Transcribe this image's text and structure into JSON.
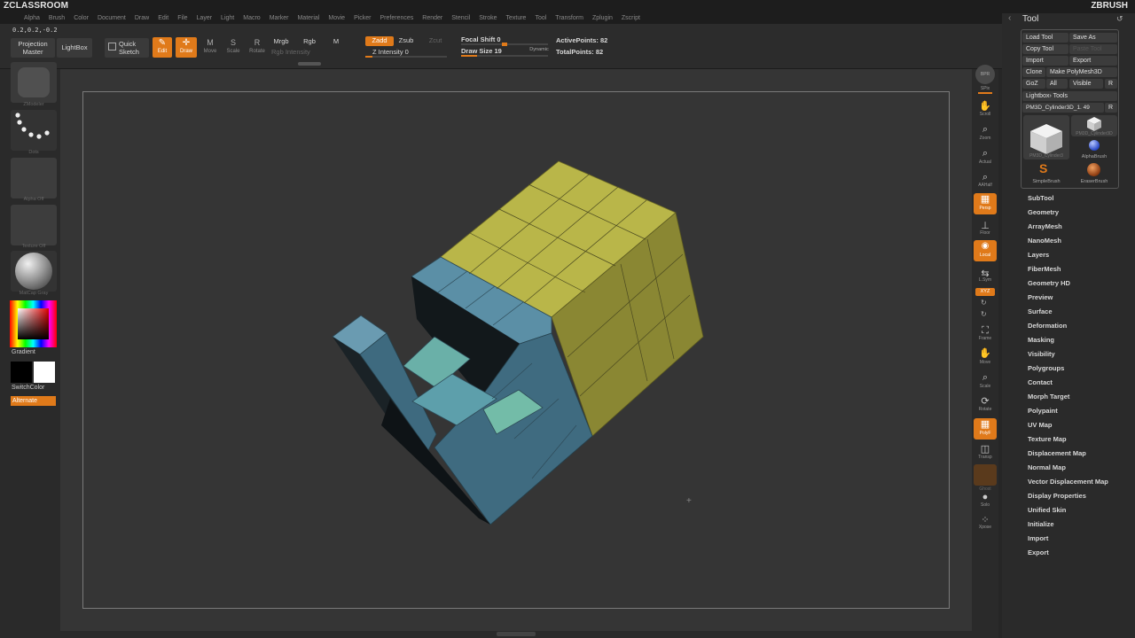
{
  "app": {
    "title": "ZCLASSROOM",
    "brand": "ZBRUSH"
  },
  "menubar": [
    "Alpha",
    "Brush",
    "Color",
    "Document",
    "Draw",
    "Edit",
    "File",
    "Layer",
    "Light",
    "Macro",
    "Marker",
    "Material",
    "Movie",
    "Picker",
    "Preferences",
    "Render",
    "Stencil",
    "Stroke",
    "Texture",
    "Tool",
    "Transform",
    "Zplugin",
    "Zscript"
  ],
  "toolbar": {
    "coords": "0.2,0.2,-0.2",
    "projection_master": [
      "Projection",
      "Master"
    ],
    "lightbox": "LightBox",
    "quick_sketch": [
      "Quick",
      "Sketch"
    ],
    "edit": "Edit",
    "draw": "Draw",
    "move": "Move",
    "scale": "Scale",
    "rotate": "Rotate",
    "mrgb": "Mrgb",
    "rgb": "Rgb",
    "m": "M",
    "rgb_intensity": "Rgb Intensity",
    "zadd": "Zadd",
    "zsub": "Zsub",
    "zcut": "Zcut",
    "z_intensity": "Z Intensity 0",
    "focal_shift": "Focal Shift 0",
    "draw_size": "Draw Size 19",
    "dynamic": "Dynamic",
    "active_points": "ActivePoints: 82",
    "total_points": "TotalPoints: 82"
  },
  "left": {
    "tool_caption": "ZModeler",
    "stroke_caption": "Dots",
    "alpha_caption": "Alpha Off",
    "texture_caption": "Texture Off",
    "material_caption": "MatCap Gray",
    "gradient": "Gradient",
    "switch_color": "SwitchColor",
    "alternate": "Alternate"
  },
  "right": {
    "spix": "SPix",
    "spix_value": "3",
    "bpr": "BPR",
    "scroll": "Scroll",
    "zoom": "Zoom",
    "actual": "Actual",
    "aahalf": "AAHalf",
    "persp": "Persp",
    "floor": "Floor",
    "local": "Local",
    "lsym": "L.Sym",
    "xyz": "XYZ",
    "frame": "Frame",
    "move": "Move",
    "scale": "Scale",
    "rotate": "Rotate",
    "polyf": "PolyF",
    "transp": "Transp",
    "ghost": "Ghost",
    "solo": "Solo",
    "xpose": "Xpose"
  },
  "tool_palette": {
    "title": "Tool",
    "load_tool": "Load Tool",
    "save_as": "Save As",
    "copy_tool": "Copy Tool",
    "paste_tool": "Paste Tool",
    "import": "Import",
    "export": "Export",
    "clone": "Clone",
    "make_polymesh": "Make PolyMesh3D",
    "goz": "GoZ",
    "all": "All",
    "visible": "Visible",
    "r": "R",
    "lightbox_tools": "Lightbox› Tools",
    "current_tool": "PM3D_Cylinder3D_1. 49",
    "thumbs": [
      "PM3D_Cylinder3",
      "PM3D_Cylinder3D",
      "AlphaBrush",
      "SimpleBrush",
      "EraserBrush"
    ],
    "menus": [
      "SubTool",
      "Geometry",
      "ArrayMesh",
      "NanoMesh",
      "Layers",
      "FiberMesh",
      "Geometry HD",
      "Preview",
      "Surface",
      "Deformation",
      "Masking",
      "Visibility",
      "Polygroups",
      "Contact",
      "Morph Target",
      "Polypaint",
      "UV Map",
      "Texture Map",
      "Displacement Map",
      "Normal Map",
      "Vector Displacement Map",
      "Display Properties",
      "Unified Skin",
      "Initialize",
      "Import",
      "Export"
    ]
  },
  "colors": {
    "accent": "#e07a1a",
    "yellow_faces": "#b9b649",
    "blue_faces": "#5d8fa8",
    "teal_faces": "#6ab0a8"
  }
}
